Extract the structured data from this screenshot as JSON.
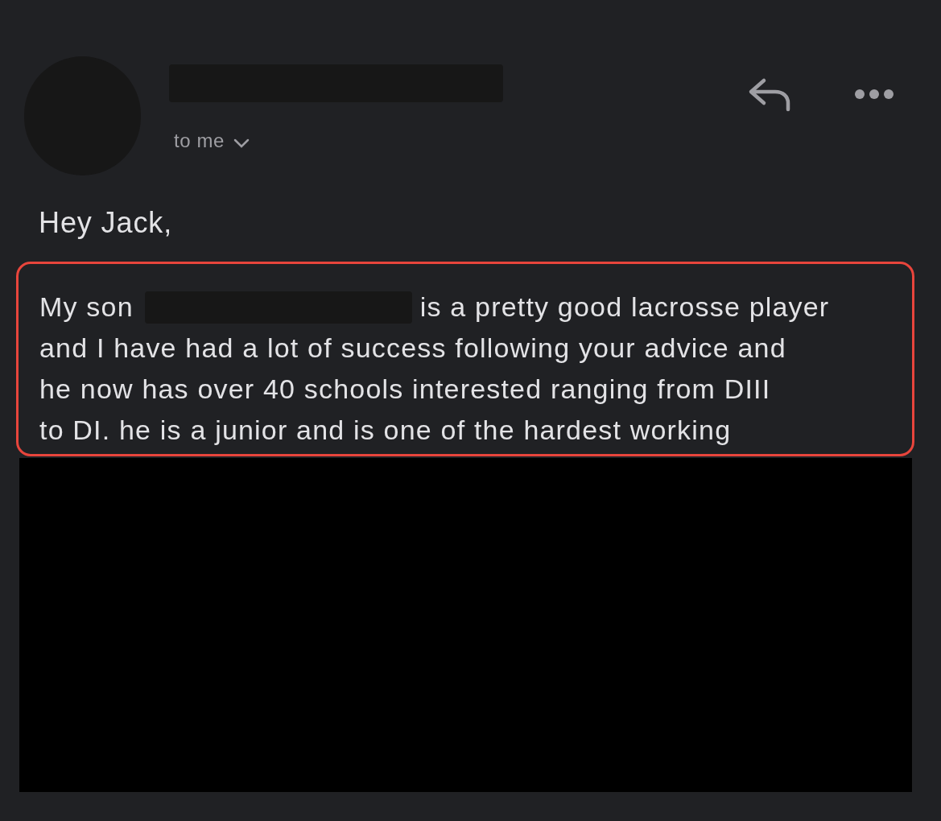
{
  "header": {
    "recipient_label": "to me"
  },
  "greeting": "Hey Jack,",
  "highlighted_paragraph": {
    "lead": "My son",
    "first_line_rest": "is a pretty good lacrosse player",
    "lines": [
      "and I have had a lot of success following your advice and",
      "he now has over 40 schools interested ranging from DIII",
      "to DI. he is a junior and is one of the hardest working"
    ]
  }
}
